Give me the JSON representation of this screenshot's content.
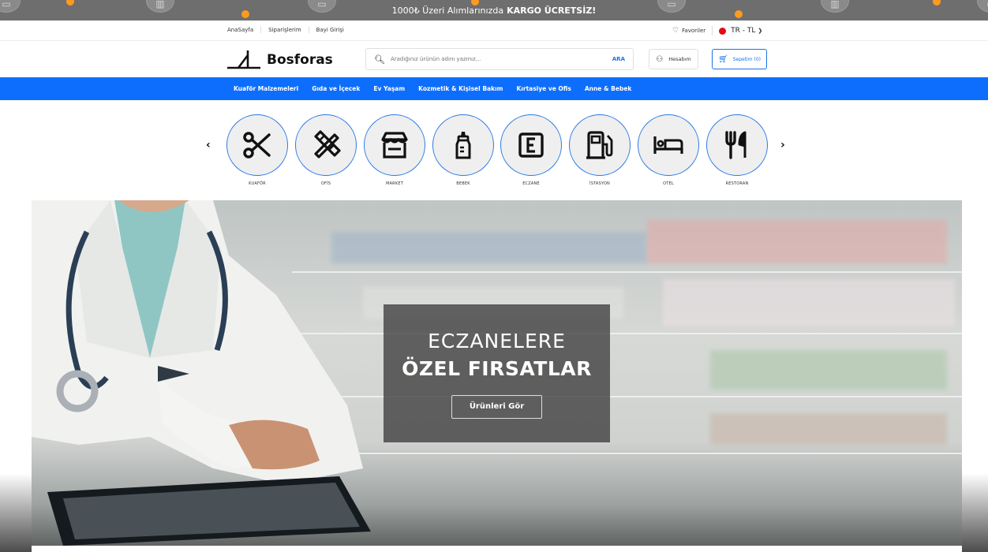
{
  "announcement": {
    "prefix": "1000₺ Üzeri Alımlarınızda",
    "bold": "KARGO ÜCRETSİZ!"
  },
  "topnav": {
    "links": [
      "AnaSayfa",
      "Siparişlerim",
      "Bayi Girişi"
    ],
    "favorites": "Favoriler",
    "lang": "TR - TL"
  },
  "header": {
    "logo_text": "Bosforas",
    "search_placeholder": "Aradığınız ürünün adını yazınız...",
    "search_button": "ARA",
    "account": "Hesabım",
    "cart": "Sepetim (0)"
  },
  "categories": [
    "Kuaför Malzemeleri",
    "Gıda ve İçecek",
    "Ev Yaşam",
    "Kozmetik & Kişisel Bakım",
    "Kırtasiye ve Ofis",
    "Anne & Bebek"
  ],
  "sectors": [
    {
      "label": "KUAFÖR",
      "icon": "scissors-icon"
    },
    {
      "label": "OFİS",
      "icon": "office-tools-icon"
    },
    {
      "label": "MARKET",
      "icon": "store-icon"
    },
    {
      "label": "BEBEK",
      "icon": "baby-bottle-icon"
    },
    {
      "label": "ECZANE",
      "icon": "pharmacy-icon"
    },
    {
      "label": "İSTASYON",
      "icon": "fuel-pump-icon"
    },
    {
      "label": "OTEL",
      "icon": "bed-icon"
    },
    {
      "label": "RESTORAN",
      "icon": "fork-knife-icon"
    }
  ],
  "hero": {
    "line1": "ECZANELERE",
    "line2": "ÖZEL FIRSATLAR",
    "button": "Ürünleri Gör"
  },
  "colors": {
    "primary": "#0d6efd",
    "announce_bg": "#6e6e6e",
    "accent_dot": "#ff9a1f"
  }
}
